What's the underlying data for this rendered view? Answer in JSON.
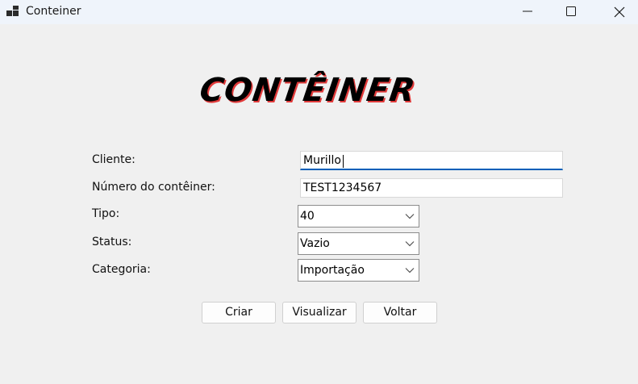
{
  "window": {
    "title": "Conteiner"
  },
  "header": {
    "logo_text": "CONTÊINER"
  },
  "form": {
    "cliente_label": "Cliente:",
    "cliente_value": "Murillo",
    "numero_label": "Número do contêiner:",
    "numero_value": "TEST1234567",
    "tipo_label": "Tipo:",
    "tipo_value": "40",
    "status_label": "Status:",
    "status_value": "Vazio",
    "categoria_label": "Categoria:",
    "categoria_value": "Importação"
  },
  "actions": {
    "criar_label": "Criar",
    "visualizar_label": "Visualizar",
    "voltar_label": "Voltar"
  },
  "colors": {
    "focus_accent": "#005fb8",
    "logo_shadow": "#e13a3a",
    "background": "#f0f0f0"
  },
  "icons": {
    "app": "app-icon",
    "minimize": "minimize-icon",
    "maximize": "maximize-icon",
    "close": "close-icon",
    "dropdown": "chevron-down-icon"
  }
}
